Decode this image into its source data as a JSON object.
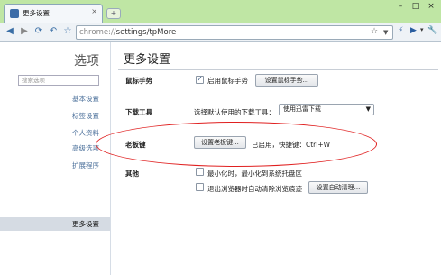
{
  "tab": {
    "title": "更多设置",
    "close": "×",
    "new_tab": "+"
  },
  "window": {
    "min": "–",
    "max": "□",
    "close": "×"
  },
  "toolbar": {
    "url_scheme": "chrome://",
    "url_path": "settings/tpMore",
    "icons": [
      "back-icon",
      "forward-icon",
      "reload-icon",
      "undo-icon",
      "home-icon",
      "star-icon",
      "bookmark-star-icon",
      "dropdown-icon",
      "lightning-icon",
      "play-icon",
      "page-icon",
      "wrench-icon"
    ]
  },
  "leftnav": {
    "heading": "选项",
    "search_placeholder": "搜索选项",
    "items": [
      "基本设置",
      "标签设置",
      "个人资料",
      "高级选项",
      "扩展程序"
    ],
    "selected": "更多设置"
  },
  "main": {
    "title": "更多设置",
    "mouse": {
      "label": "鼠标手势",
      "checkbox_label": "启用鼠标手势",
      "checked": true,
      "button": "设置鼠标手势..."
    },
    "download": {
      "label": "下载工具",
      "prompt": "选择默认使用的下载工具：",
      "selected": "使用迅雷下载"
    },
    "boss": {
      "label": "老板键",
      "button": "设置老板键...",
      "status": "已启用，快捷键：Ctrl+W"
    },
    "other": {
      "label": "其他",
      "option1": "最小化时，最小化到系统托盘区",
      "option1_checked": false,
      "option2": "退出浏览器时自动清除浏览痕迹",
      "option2_checked": false,
      "button": "设置自动清理..."
    }
  },
  "annotation_color": "#e02020"
}
